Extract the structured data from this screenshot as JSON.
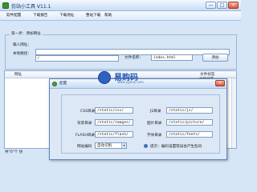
{
  "window": {
    "title": "仿站小工具 V11.1",
    "controls": {
      "minimize": "—",
      "maximize": "□",
      "close": "×"
    }
  },
  "menu": [
    "软件配置",
    "下载报告",
    "下载地址",
    "整站下载",
    "帮助"
  ],
  "step1": {
    "group_label": "第一步：添加网址",
    "url_label": "输入网址：",
    "url_value": "",
    "local_label": "本地路径：",
    "local_value": "/",
    "filename_label": "文件名称：",
    "filename_value": "index.html",
    "add_button": "添加"
  },
  "list": {
    "columns": [
      "网址",
      "文件状态",
      "文件状态"
    ]
  },
  "status": {
    "text": "共\"0\"个 仿"
  },
  "dialog": {
    "title": "配置",
    "close": "×",
    "fields": {
      "css_label": "CSS目录",
      "css_value": "/static/css/",
      "js_label": "JS目录",
      "js_value": "/static/js/",
      "bg_label": "背景目录",
      "bg_value": "/static/images/",
      "img_label": "图片目录",
      "img_value": "/static/picture/",
      "flash_label": "FLASH目录",
      "flash_value": "/static/flash/",
      "font_label": "字体目录",
      "font_value": "/static/fonts/",
      "encoding_label": "网站编码",
      "encoding_value": "自动识别",
      "hint": "提示：编码设置错误会产生乱码"
    }
  },
  "watermark": {
    "text": "易购码",
    "sub": "www.ygmai.com"
  },
  "colors": {
    "background": "#d7e6f7",
    "accent": "#2457b4",
    "close": "#d9533c"
  },
  "icons": {
    "app": "app-icon",
    "dialog": "gear-icon",
    "hint": "info-icon",
    "dropdown": "chevron-down-icon"
  }
}
